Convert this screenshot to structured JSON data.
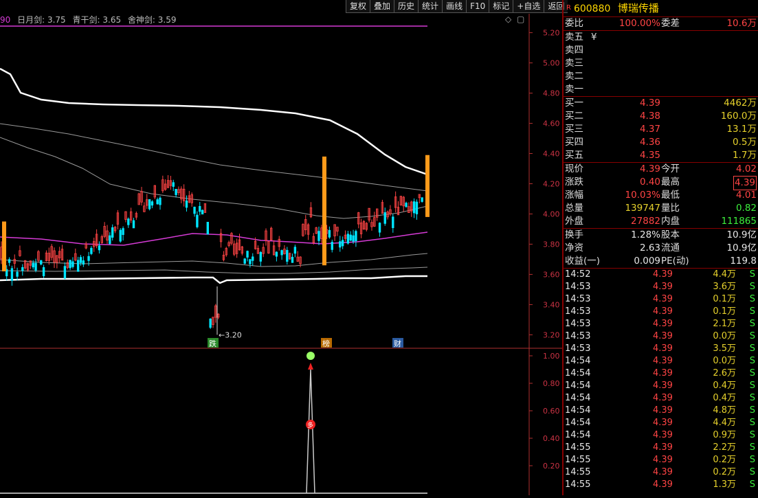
{
  "toolbar": {
    "buttons": [
      "复权",
      "叠加",
      "历史",
      "统计",
      "画线",
      "F10",
      "标记",
      "+自选",
      "返回"
    ]
  },
  "legend": {
    "prefix": "90",
    "items": [
      "日月剑: 3.75",
      "青干剑: 3.65",
      "舍神剑: 3.59"
    ]
  },
  "colors": {
    "up": "#ff4444",
    "down": "#00e5ff",
    "ma_white": "#ffffff",
    "ma_gray": "#9a9a9a",
    "ma_magenta": "#d63bd6",
    "limit_bar": "#ff9a1a",
    "axis": "#b03030"
  },
  "main_axis": {
    "labels": [
      "5.20",
      "5.00",
      "4.80",
      "4.60",
      "4.40",
      "4.20",
      "4.00",
      "3.80",
      "3.60",
      "3.40",
      "3.20"
    ],
    "min": 3.12,
    "max": 5.28
  },
  "sub_axis": {
    "labels": [
      "1.00",
      "0.80",
      "0.60",
      "0.40",
      "0.20"
    ],
    "min": 0,
    "max": 1.05
  },
  "annotations": {
    "low_label": "3.20",
    "tags": [
      "跌",
      "榜",
      "财"
    ],
    "sub_marker": "多"
  },
  "panel": {
    "code": "600880",
    "r_badge": "R",
    "name": "博瑞传播",
    "weibi": {
      "label": "委比",
      "value": "100.00%",
      "label2": "委差",
      "value2": "10.6万"
    },
    "sell": [
      {
        "label": "卖五",
        "price": "¥"
      },
      {
        "label": "卖四",
        "price": ""
      },
      {
        "label": "卖三",
        "price": ""
      },
      {
        "label": "卖二",
        "price": ""
      },
      {
        "label": "卖一",
        "price": ""
      }
    ],
    "buy": [
      {
        "label": "买一",
        "price": "4.39",
        "vol": "4462万"
      },
      {
        "label": "买二",
        "price": "4.38",
        "vol": "160.0万"
      },
      {
        "label": "买三",
        "price": "4.37",
        "vol": "13.1万"
      },
      {
        "label": "买四",
        "price": "4.36",
        "vol": "0.5万"
      },
      {
        "label": "买五",
        "price": "4.35",
        "vol": "1.7万"
      }
    ],
    "quote": [
      {
        "l": "现价",
        "v": "4.39",
        "vc": "red",
        "l2": "今开",
        "v2": "4.02",
        "v2c": "red"
      },
      {
        "l": "涨跌",
        "v": "0.40",
        "vc": "red",
        "l2": "最高",
        "v2": "4.39",
        "v2c": "red"
      },
      {
        "l": "涨幅",
        "v": "10.03%",
        "vc": "red",
        "l2": "最低",
        "v2": "4.01",
        "v2c": "red"
      },
      {
        "l": "总量",
        "v": "139747",
        "vc": "yel",
        "l2": "量比",
        "v2": "0.82",
        "v2c": "grn"
      },
      {
        "l": "外盘",
        "v": "27882",
        "vc": "red",
        "l2": "内盘",
        "v2": "111865",
        "v2c": "grn"
      }
    ],
    "fund": [
      {
        "l": "换手",
        "v": "1.28%",
        "l2": "股本",
        "v2": "10.9亿"
      },
      {
        "l": "净资",
        "v": "2.63",
        "l2": "流通",
        "v2": "10.9亿"
      },
      {
        "l": "收益(一)",
        "v": "0.009",
        "l2": "PE(动)",
        "v2": "119.8"
      }
    ],
    "ticks": [
      {
        "t": "14:52",
        "p": "4.39",
        "v": "4.4万",
        "f": "S"
      },
      {
        "t": "14:53",
        "p": "4.39",
        "v": "3.6万",
        "f": "S"
      },
      {
        "t": "14:53",
        "p": "4.39",
        "v": "0.1万",
        "f": "S"
      },
      {
        "t": "14:53",
        "p": "4.39",
        "v": "0.1万",
        "f": "S"
      },
      {
        "t": "14:53",
        "p": "4.39",
        "v": "2.1万",
        "f": "S"
      },
      {
        "t": "14:53",
        "p": "4.39",
        "v": "0.0万",
        "f": "S"
      },
      {
        "t": "14:53",
        "p": "4.39",
        "v": "3.5万",
        "f": "S"
      },
      {
        "t": "14:54",
        "p": "4.39",
        "v": "0.0万",
        "f": "S"
      },
      {
        "t": "14:54",
        "p": "4.39",
        "v": "2.6万",
        "f": "S"
      },
      {
        "t": "14:54",
        "p": "4.39",
        "v": "0.4万",
        "f": "S"
      },
      {
        "t": "14:54",
        "p": "4.39",
        "v": "0.4万",
        "f": "S"
      },
      {
        "t": "14:54",
        "p": "4.39",
        "v": "4.8万",
        "f": "S"
      },
      {
        "t": "14:54",
        "p": "4.39",
        "v": "4.4万",
        "f": "S"
      },
      {
        "t": "14:54",
        "p": "4.39",
        "v": "0.9万",
        "f": "S"
      },
      {
        "t": "14:55",
        "p": "4.39",
        "v": "2.2万",
        "f": "S"
      },
      {
        "t": "14:55",
        "p": "4.39",
        "v": "0.2万",
        "f": "S"
      },
      {
        "t": "14:55",
        "p": "4.39",
        "v": "0.2万",
        "f": "S"
      },
      {
        "t": "14:55",
        "p": "4.39",
        "v": "1.3万",
        "f": "S"
      }
    ]
  }
}
